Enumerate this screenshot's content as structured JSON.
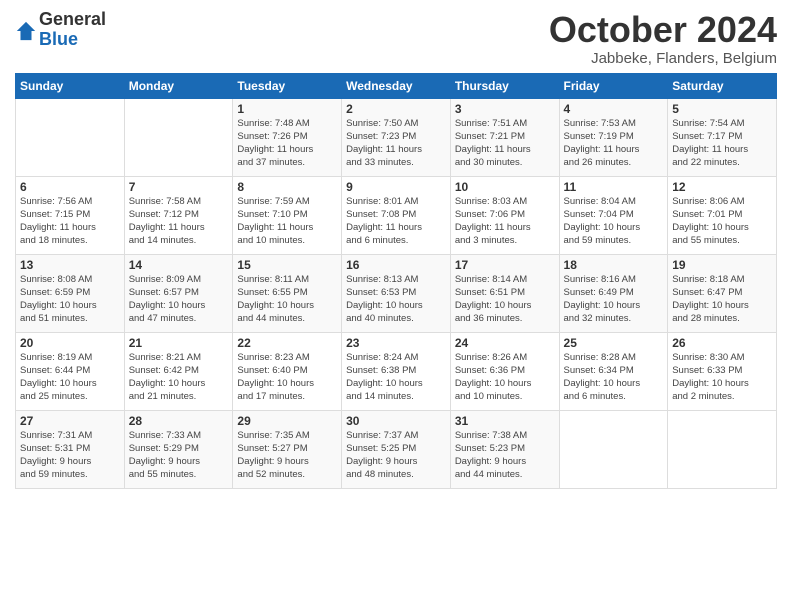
{
  "logo": {
    "general": "General",
    "blue": "Blue"
  },
  "title": "October 2024",
  "subtitle": "Jabbeke, Flanders, Belgium",
  "days_of_week": [
    "Sunday",
    "Monday",
    "Tuesday",
    "Wednesday",
    "Thursday",
    "Friday",
    "Saturday"
  ],
  "weeks": [
    [
      {
        "day": "",
        "info": ""
      },
      {
        "day": "",
        "info": ""
      },
      {
        "day": "1",
        "info": "Sunrise: 7:48 AM\nSunset: 7:26 PM\nDaylight: 11 hours\nand 37 minutes."
      },
      {
        "day": "2",
        "info": "Sunrise: 7:50 AM\nSunset: 7:23 PM\nDaylight: 11 hours\nand 33 minutes."
      },
      {
        "day": "3",
        "info": "Sunrise: 7:51 AM\nSunset: 7:21 PM\nDaylight: 11 hours\nand 30 minutes."
      },
      {
        "day": "4",
        "info": "Sunrise: 7:53 AM\nSunset: 7:19 PM\nDaylight: 11 hours\nand 26 minutes."
      },
      {
        "day": "5",
        "info": "Sunrise: 7:54 AM\nSunset: 7:17 PM\nDaylight: 11 hours\nand 22 minutes."
      }
    ],
    [
      {
        "day": "6",
        "info": "Sunrise: 7:56 AM\nSunset: 7:15 PM\nDaylight: 11 hours\nand 18 minutes."
      },
      {
        "day": "7",
        "info": "Sunrise: 7:58 AM\nSunset: 7:12 PM\nDaylight: 11 hours\nand 14 minutes."
      },
      {
        "day": "8",
        "info": "Sunrise: 7:59 AM\nSunset: 7:10 PM\nDaylight: 11 hours\nand 10 minutes."
      },
      {
        "day": "9",
        "info": "Sunrise: 8:01 AM\nSunset: 7:08 PM\nDaylight: 11 hours\nand 6 minutes."
      },
      {
        "day": "10",
        "info": "Sunrise: 8:03 AM\nSunset: 7:06 PM\nDaylight: 11 hours\nand 3 minutes."
      },
      {
        "day": "11",
        "info": "Sunrise: 8:04 AM\nSunset: 7:04 PM\nDaylight: 10 hours\nand 59 minutes."
      },
      {
        "day": "12",
        "info": "Sunrise: 8:06 AM\nSunset: 7:01 PM\nDaylight: 10 hours\nand 55 minutes."
      }
    ],
    [
      {
        "day": "13",
        "info": "Sunrise: 8:08 AM\nSunset: 6:59 PM\nDaylight: 10 hours\nand 51 minutes."
      },
      {
        "day": "14",
        "info": "Sunrise: 8:09 AM\nSunset: 6:57 PM\nDaylight: 10 hours\nand 47 minutes."
      },
      {
        "day": "15",
        "info": "Sunrise: 8:11 AM\nSunset: 6:55 PM\nDaylight: 10 hours\nand 44 minutes."
      },
      {
        "day": "16",
        "info": "Sunrise: 8:13 AM\nSunset: 6:53 PM\nDaylight: 10 hours\nand 40 minutes."
      },
      {
        "day": "17",
        "info": "Sunrise: 8:14 AM\nSunset: 6:51 PM\nDaylight: 10 hours\nand 36 minutes."
      },
      {
        "day": "18",
        "info": "Sunrise: 8:16 AM\nSunset: 6:49 PM\nDaylight: 10 hours\nand 32 minutes."
      },
      {
        "day": "19",
        "info": "Sunrise: 8:18 AM\nSunset: 6:47 PM\nDaylight: 10 hours\nand 28 minutes."
      }
    ],
    [
      {
        "day": "20",
        "info": "Sunrise: 8:19 AM\nSunset: 6:44 PM\nDaylight: 10 hours\nand 25 minutes."
      },
      {
        "day": "21",
        "info": "Sunrise: 8:21 AM\nSunset: 6:42 PM\nDaylight: 10 hours\nand 21 minutes."
      },
      {
        "day": "22",
        "info": "Sunrise: 8:23 AM\nSunset: 6:40 PM\nDaylight: 10 hours\nand 17 minutes."
      },
      {
        "day": "23",
        "info": "Sunrise: 8:24 AM\nSunset: 6:38 PM\nDaylight: 10 hours\nand 14 minutes."
      },
      {
        "day": "24",
        "info": "Sunrise: 8:26 AM\nSunset: 6:36 PM\nDaylight: 10 hours\nand 10 minutes."
      },
      {
        "day": "25",
        "info": "Sunrise: 8:28 AM\nSunset: 6:34 PM\nDaylight: 10 hours\nand 6 minutes."
      },
      {
        "day": "26",
        "info": "Sunrise: 8:30 AM\nSunset: 6:33 PM\nDaylight: 10 hours\nand 2 minutes."
      }
    ],
    [
      {
        "day": "27",
        "info": "Sunrise: 7:31 AM\nSunset: 5:31 PM\nDaylight: 9 hours\nand 59 minutes."
      },
      {
        "day": "28",
        "info": "Sunrise: 7:33 AM\nSunset: 5:29 PM\nDaylight: 9 hours\nand 55 minutes."
      },
      {
        "day": "29",
        "info": "Sunrise: 7:35 AM\nSunset: 5:27 PM\nDaylight: 9 hours\nand 52 minutes."
      },
      {
        "day": "30",
        "info": "Sunrise: 7:37 AM\nSunset: 5:25 PM\nDaylight: 9 hours\nand 48 minutes."
      },
      {
        "day": "31",
        "info": "Sunrise: 7:38 AM\nSunset: 5:23 PM\nDaylight: 9 hours\nand 44 minutes."
      },
      {
        "day": "",
        "info": ""
      },
      {
        "day": "",
        "info": ""
      }
    ]
  ]
}
